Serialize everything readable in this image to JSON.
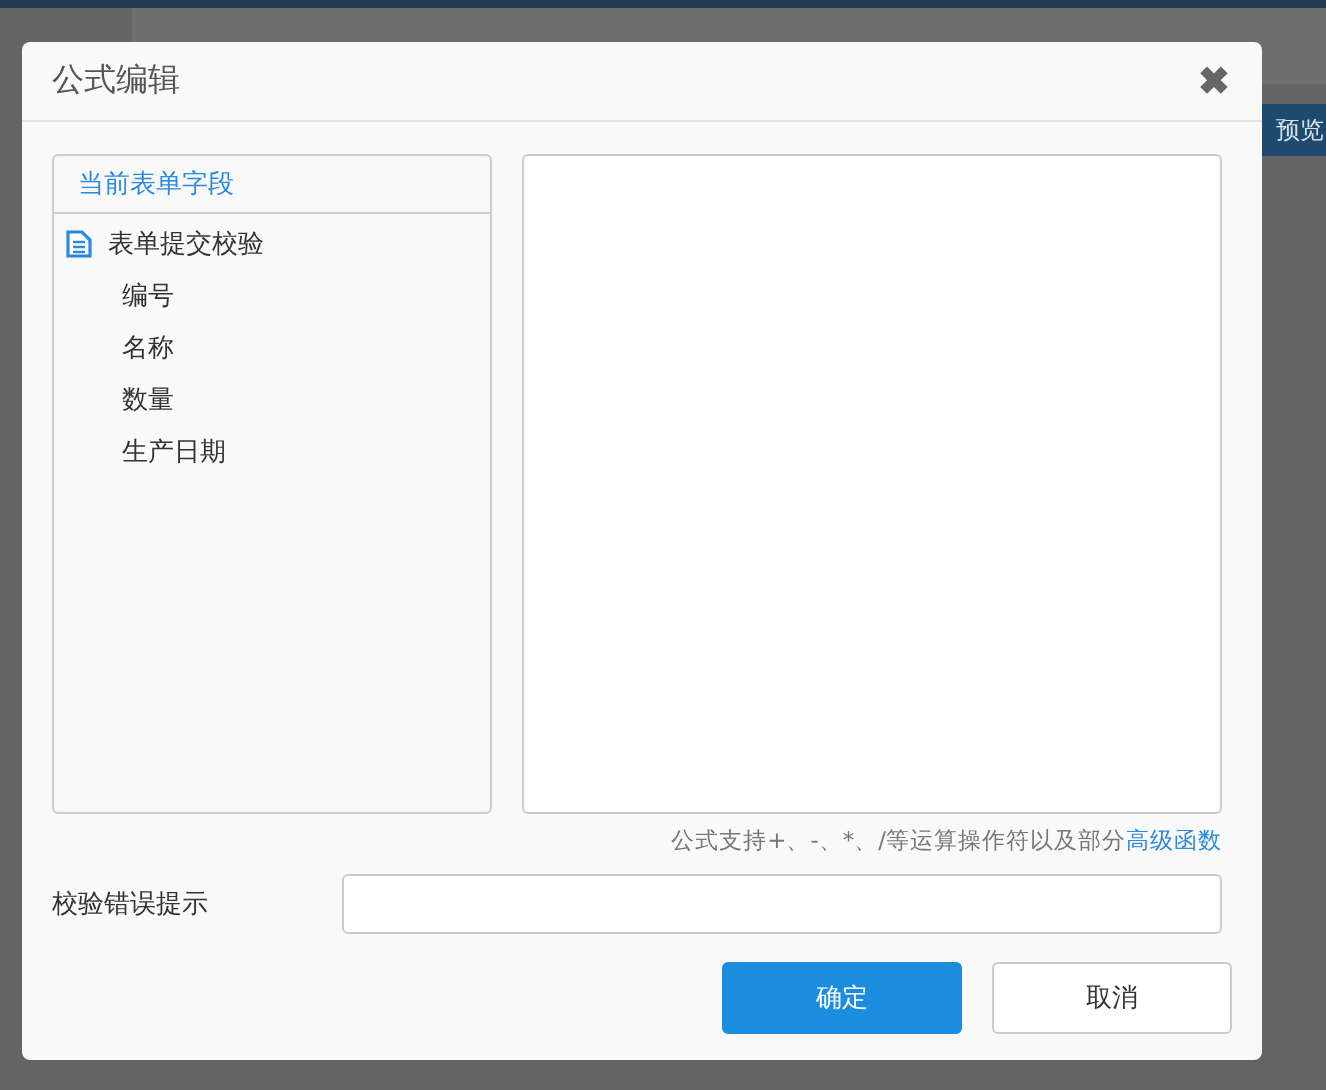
{
  "background": {
    "preview_button": "预览"
  },
  "dialog": {
    "title": "公式编辑",
    "close": "✖",
    "field_panel": {
      "title": "当前表单字段",
      "tree": [
        {
          "label": "表单提交校验",
          "children": [
            {
              "label": "编号"
            },
            {
              "label": "名称"
            },
            {
              "label": "数量"
            },
            {
              "label": "生产日期"
            }
          ]
        }
      ]
    },
    "hint": "公式支持+、-、*、/等运算操作符以及部分",
    "hint_link": "高级函数",
    "error_label": "校验错误提示",
    "buttons": [
      {
        "label": "确定",
        "kind": "primary"
      },
      {
        "label": "取消",
        "kind": "secondary"
      }
    ]
  }
}
